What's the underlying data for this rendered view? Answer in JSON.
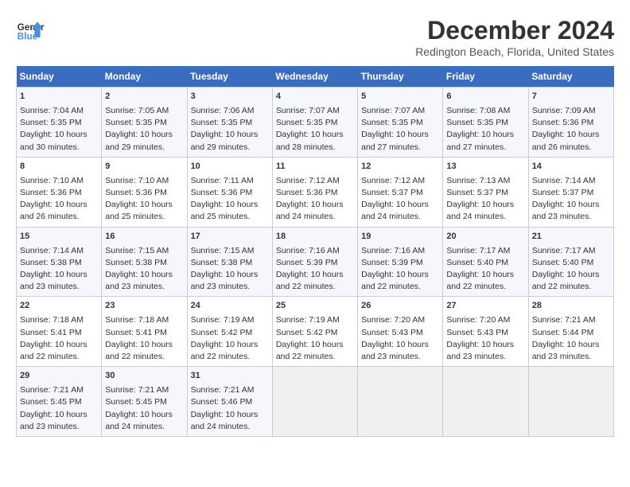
{
  "header": {
    "logo_line1": "General",
    "logo_line2": "Blue",
    "title": "December 2024",
    "subtitle": "Redington Beach, Florida, United States"
  },
  "days_of_week": [
    "Sunday",
    "Monday",
    "Tuesday",
    "Wednesday",
    "Thursday",
    "Friday",
    "Saturday"
  ],
  "weeks": [
    [
      {
        "day": 1,
        "sunrise": "7:04 AM",
        "sunset": "5:35 PM",
        "daylight": "10 hours and 30 minutes."
      },
      {
        "day": 2,
        "sunrise": "7:05 AM",
        "sunset": "5:35 PM",
        "daylight": "10 hours and 29 minutes."
      },
      {
        "day": 3,
        "sunrise": "7:06 AM",
        "sunset": "5:35 PM",
        "daylight": "10 hours and 29 minutes."
      },
      {
        "day": 4,
        "sunrise": "7:07 AM",
        "sunset": "5:35 PM",
        "daylight": "10 hours and 28 minutes."
      },
      {
        "day": 5,
        "sunrise": "7:07 AM",
        "sunset": "5:35 PM",
        "daylight": "10 hours and 27 minutes."
      },
      {
        "day": 6,
        "sunrise": "7:08 AM",
        "sunset": "5:35 PM",
        "daylight": "10 hours and 27 minutes."
      },
      {
        "day": 7,
        "sunrise": "7:09 AM",
        "sunset": "5:36 PM",
        "daylight": "10 hours and 26 minutes."
      }
    ],
    [
      {
        "day": 8,
        "sunrise": "7:10 AM",
        "sunset": "5:36 PM",
        "daylight": "10 hours and 26 minutes."
      },
      {
        "day": 9,
        "sunrise": "7:10 AM",
        "sunset": "5:36 PM",
        "daylight": "10 hours and 25 minutes."
      },
      {
        "day": 10,
        "sunrise": "7:11 AM",
        "sunset": "5:36 PM",
        "daylight": "10 hours and 25 minutes."
      },
      {
        "day": 11,
        "sunrise": "7:12 AM",
        "sunset": "5:36 PM",
        "daylight": "10 hours and 24 minutes."
      },
      {
        "day": 12,
        "sunrise": "7:12 AM",
        "sunset": "5:37 PM",
        "daylight": "10 hours and 24 minutes."
      },
      {
        "day": 13,
        "sunrise": "7:13 AM",
        "sunset": "5:37 PM",
        "daylight": "10 hours and 24 minutes."
      },
      {
        "day": 14,
        "sunrise": "7:14 AM",
        "sunset": "5:37 PM",
        "daylight": "10 hours and 23 minutes."
      }
    ],
    [
      {
        "day": 15,
        "sunrise": "7:14 AM",
        "sunset": "5:38 PM",
        "daylight": "10 hours and 23 minutes."
      },
      {
        "day": 16,
        "sunrise": "7:15 AM",
        "sunset": "5:38 PM",
        "daylight": "10 hours and 23 minutes."
      },
      {
        "day": 17,
        "sunrise": "7:15 AM",
        "sunset": "5:38 PM",
        "daylight": "10 hours and 23 minutes."
      },
      {
        "day": 18,
        "sunrise": "7:16 AM",
        "sunset": "5:39 PM",
        "daylight": "10 hours and 22 minutes."
      },
      {
        "day": 19,
        "sunrise": "7:16 AM",
        "sunset": "5:39 PM",
        "daylight": "10 hours and 22 minutes."
      },
      {
        "day": 20,
        "sunrise": "7:17 AM",
        "sunset": "5:40 PM",
        "daylight": "10 hours and 22 minutes."
      },
      {
        "day": 21,
        "sunrise": "7:17 AM",
        "sunset": "5:40 PM",
        "daylight": "10 hours and 22 minutes."
      }
    ],
    [
      {
        "day": 22,
        "sunrise": "7:18 AM",
        "sunset": "5:41 PM",
        "daylight": "10 hours and 22 minutes."
      },
      {
        "day": 23,
        "sunrise": "7:18 AM",
        "sunset": "5:41 PM",
        "daylight": "10 hours and 22 minutes."
      },
      {
        "day": 24,
        "sunrise": "7:19 AM",
        "sunset": "5:42 PM",
        "daylight": "10 hours and 22 minutes."
      },
      {
        "day": 25,
        "sunrise": "7:19 AM",
        "sunset": "5:42 PM",
        "daylight": "10 hours and 22 minutes."
      },
      {
        "day": 26,
        "sunrise": "7:20 AM",
        "sunset": "5:43 PM",
        "daylight": "10 hours and 23 minutes."
      },
      {
        "day": 27,
        "sunrise": "7:20 AM",
        "sunset": "5:43 PM",
        "daylight": "10 hours and 23 minutes."
      },
      {
        "day": 28,
        "sunrise": "7:21 AM",
        "sunset": "5:44 PM",
        "daylight": "10 hours and 23 minutes."
      }
    ],
    [
      {
        "day": 29,
        "sunrise": "7:21 AM",
        "sunset": "5:45 PM",
        "daylight": "10 hours and 23 minutes."
      },
      {
        "day": 30,
        "sunrise": "7:21 AM",
        "sunset": "5:45 PM",
        "daylight": "10 hours and 24 minutes."
      },
      {
        "day": 31,
        "sunrise": "7:21 AM",
        "sunset": "5:46 PM",
        "daylight": "10 hours and 24 minutes."
      },
      null,
      null,
      null,
      null
    ]
  ]
}
